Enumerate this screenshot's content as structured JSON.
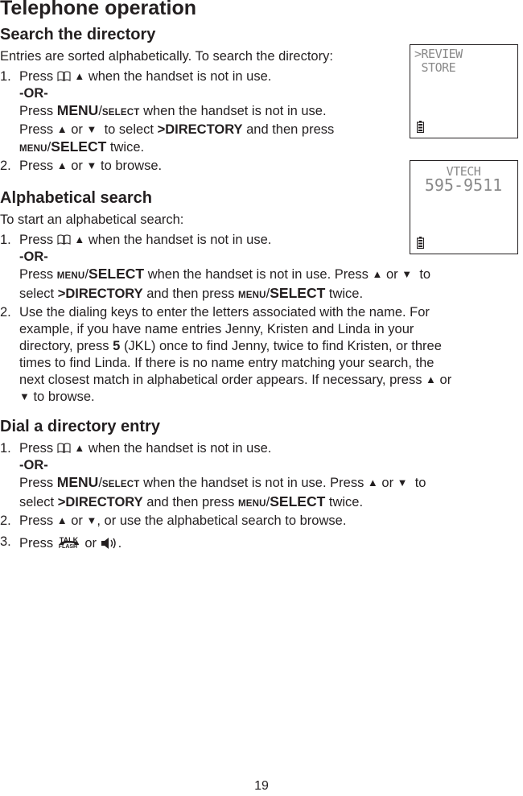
{
  "page": {
    "title": "Telephone operation",
    "page_number": "19"
  },
  "lcd_screens": [
    {
      "lines": [
        ">REVIEW",
        " STORE"
      ],
      "icon": "battery-icon"
    },
    {
      "lines": [
        "VTECH",
        "595-9511"
      ],
      "icon": "battery-icon"
    }
  ],
  "sections": {
    "search": {
      "heading": "Search the directory",
      "intro": "Entries are sorted alphabetically. To search the directory:",
      "step1": {
        "num": "1.",
        "press": "Press",
        "rest": "when the handset is not in use.",
        "or": "-OR-",
        "line2_press": "Press",
        "menu": "MENU",
        "slash": "/",
        "select_small": "SELECT",
        "line2_rest": "when the handset is not in use.",
        "line3_press": "Press",
        "or_word": "or",
        "line3_mid": "to select",
        "directory": ">DIRECTORY",
        "line3_rest": "and then press",
        "menu_small": "MENU",
        "select_big": "SELECT",
        "twice": "twice."
      },
      "step2": {
        "num": "2.",
        "press": "Press",
        "or_word": "or",
        "rest": "to browse."
      }
    },
    "alpha": {
      "heading": "Alphabetical search",
      "intro": "To start an alphabetical search:",
      "step1": {
        "num": "1.",
        "press": "Press",
        "rest": "when the handset is not in use.",
        "or": "-OR-",
        "line2_press": "Press",
        "menu_small": "MENU",
        "slash": "/",
        "select_big": "SELECT",
        "line2_rest": "when the handset is not in use. Press",
        "or_word": "or",
        "to": "to",
        "line3_select": "select",
        "directory": ">DIRECTORY",
        "line3_rest": "and then press",
        "twice": "twice."
      },
      "step2": {
        "num": "2.",
        "l1": "Use the dialing keys to enter the letters associated with the name. For",
        "l2": "example, if you have name entries Jenny, Kristen and Linda in your",
        "l3a": "directory, press",
        "key": "5",
        "l3b": "(JKL) once to find Jenny, twice to find Kristen, or three",
        "l4": "times to find Linda. If there is no name entry matching your search, the",
        "l5": "next closest match in alphabetical order appears. If necessary, press",
        "or_word": "or",
        "l6": "to browse."
      }
    },
    "dial": {
      "heading": "Dial a directory entry",
      "step1": {
        "num": "1.",
        "press": "Press",
        "rest": "when the handset is not in use.",
        "or": "-OR-",
        "line2_press": "Press",
        "menu": "MENU",
        "slash": "/",
        "select_small": "SELECT",
        "line2_rest": "when the handset is not in use. Press",
        "or_word": "or",
        "to": "to",
        "line3_select": "select",
        "directory": ">DIRECTORY",
        "line3_rest": "and then press",
        "menu_small": "MENU",
        "select_big": "SELECT",
        "twice": "twice."
      },
      "step2": {
        "num": "2.",
        "press": "Press",
        "or_word": "or",
        "rest": ", or use the alphabetical search to browse."
      },
      "step3": {
        "num": "3.",
        "press": "Press",
        "talk": "TALK",
        "flash": "FLASH",
        "or_word": "or",
        "end": "."
      }
    }
  },
  "glyphs": {
    "up": "▲",
    "down": "▼"
  }
}
